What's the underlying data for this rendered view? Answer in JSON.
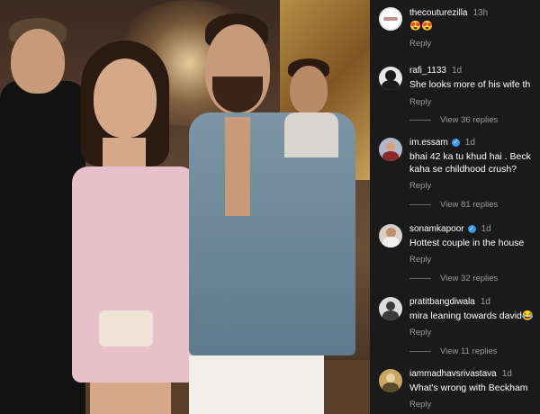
{
  "comments": [
    {
      "user": "thecouturezilla",
      "time": "13h",
      "verified": false,
      "text": "😍😍",
      "reply": "Reply",
      "avatar_color": "#ffffff",
      "view": ""
    },
    {
      "user": "rafi_1133",
      "time": "1d",
      "verified": false,
      "text": "She looks more of his wife th",
      "reply": "Reply",
      "avatar_color": "#2a2a2a",
      "view": "View 36 replies"
    },
    {
      "user": "im.essam",
      "time": "1d",
      "verified": true,
      "text": "bhai 42 ka tu khud hai . Beck",
      "text2": "kaha se childhood crush?",
      "reply": "Reply",
      "avatar_color": "#b0b8c8",
      "view": "View 81 replies"
    },
    {
      "user": "sonamkapoor",
      "time": "1d",
      "verified": true,
      "text": "Hottest couple in the house",
      "reply": "Reply",
      "avatar_color": "#d8d0c8",
      "view": "View 32 replies"
    },
    {
      "user": "pratitbangdiwala",
      "time": "1d",
      "verified": false,
      "text": "mira leaning towards david😂",
      "reply": "Reply",
      "avatar_color": "#dcdcdc",
      "view": "View 11 replies"
    },
    {
      "user": "iammadhavsrivastava",
      "time": "1d",
      "verified": false,
      "text": "What's wrong with Beckham",
      "reply": "Reply",
      "avatar_color": "#c8a860",
      "view": ""
    }
  ]
}
